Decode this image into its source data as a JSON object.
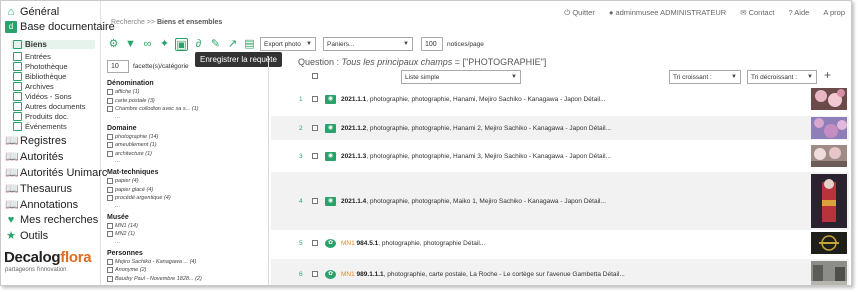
{
  "nav": {
    "items": [
      {
        "label": "Général",
        "icon": "home-icon"
      },
      {
        "label": "Base documentaire",
        "icon": "database-icon"
      }
    ],
    "sub_items": [
      {
        "label": "Biens",
        "active": true
      },
      {
        "label": "Entrées"
      },
      {
        "label": "Photothèque"
      },
      {
        "label": "Bibliothèque"
      },
      {
        "label": "Archives"
      },
      {
        "label": "Vidéos - Sons"
      },
      {
        "label": "Autres documents"
      },
      {
        "label": "Produits doc."
      },
      {
        "label": "Événements"
      }
    ],
    "sections": [
      {
        "label": "Registres",
        "icon": "book-icon"
      },
      {
        "label": "Autorités",
        "icon": "book-icon"
      },
      {
        "label": "Autorités Unimarc",
        "icon": "book-icon"
      },
      {
        "label": "Thesaurus",
        "icon": "book-icon"
      },
      {
        "label": "Annotations",
        "icon": "book-icon"
      },
      {
        "label": "Mes recherches",
        "icon": "heart-icon"
      },
      {
        "label": "Outils",
        "icon": "star-icon"
      }
    ],
    "logo": {
      "part1": "Decalog",
      "part2": "flora",
      "tagline": "partageons l'innovation"
    }
  },
  "topbar": {
    "quit": "Quitter",
    "user": "adminmusee ADMINISTRATEUR",
    "contact": "Contact",
    "help": "Aide",
    "apropos": "A prop"
  },
  "breadcrumb": {
    "part1": "Recherche >>",
    "part2": "Biens et ensembles"
  },
  "toolbar": {
    "export_select": "Export photo",
    "panier_select": "Paniers...",
    "per_page": "100",
    "per_page_label": "notices/page",
    "tooltip": "Enregistrer la requête"
  },
  "facets": {
    "count": "10",
    "count_label": "facette(s)/catégorie",
    "groups": [
      {
        "title": "Dénomination",
        "options": [
          "affiche (1)",
          "carte postale (3)",
          "Chambre collodion avec sa s... (1)"
        ]
      },
      {
        "title": "Domaine",
        "options": [
          "photographie (14)",
          "ameublement (1)",
          "architecture (1)"
        ]
      },
      {
        "title": "Mat-techniques",
        "options": [
          "papier (4)",
          "papier glacé (4)",
          "procédé argentique (4)"
        ]
      },
      {
        "title": "Musée",
        "options": [
          "MN1 (14)",
          "MN2 (1)"
        ]
      },
      {
        "title": "Personnes",
        "options": [
          "Mejiro Sachiko - Kanagawa ... (4)",
          "Anonyme (2)",
          "Baudry Paul - Novembre 1828... (2)"
        ]
      }
    ]
  },
  "results": {
    "question_label": "Question :",
    "question_text": "Tous les principaux champs",
    "question_value": "= [\"PHOTOGRAPHIE\"]",
    "list_select": "Liste simple",
    "tri_croissant": "Tri croissant :",
    "tri_decroissant": "Tri décroissant :",
    "rows": [
      {
        "num": "1",
        "id": "2021.1.1",
        "prefix": "",
        "text": ", photographie, photographie, Hanami, Mejiro Sachiko - Kanagawa - Japon",
        "detail": "Détail...",
        "icon": "camera-icon"
      },
      {
        "num": "2",
        "id": "2021.1.2",
        "prefix": "",
        "text": ", photographie, photographie, Hanami 2, Mejiro Sachiko - Kanagawa - Japon",
        "detail": "Détail...",
        "icon": "camera-icon"
      },
      {
        "num": "3",
        "id": "2021.1.3",
        "prefix": "",
        "text": ", photographie, photographie, Hanami 3, Mejiro Sachiko - Kanagawa - Japon",
        "detail": "Détail...",
        "icon": "camera-icon"
      },
      {
        "num": "4",
        "id": "2021.1.4",
        "prefix": "",
        "text": ", photographie, photographie, Maiko 1, Mejiro Sachiko - Kanagawa - Japon",
        "detail": "Détail...",
        "icon": "camera-icon"
      },
      {
        "num": "5",
        "id": "984.5.1",
        "prefix": "MN1",
        "text": ", photographie, photographie",
        "detail": "Détail...",
        "icon": "palette-icon"
      },
      {
        "num": "6",
        "id": "989.1.1.1",
        "prefix": "MN1",
        "text": ", photographie, carte postale, La Roche - Le cortège sur l'avenue Gambetta",
        "detail": "Détail...",
        "icon": "palette-icon"
      }
    ]
  }
}
